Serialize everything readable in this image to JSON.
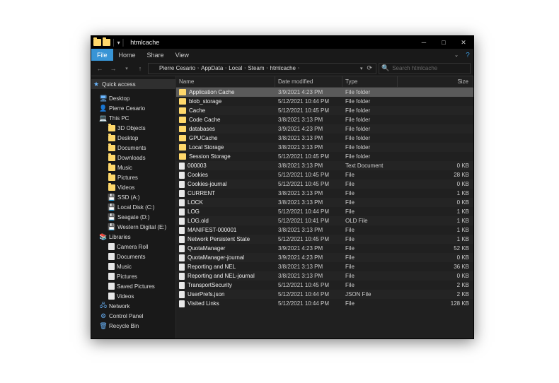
{
  "title": "htmlcache",
  "tabs": {
    "file": "File",
    "home": "Home",
    "share": "Share",
    "view": "View"
  },
  "breadcrumbs": [
    "Pierre Cesario",
    "AppData",
    "Local",
    "Steam",
    "htmlcache"
  ],
  "search_placeholder": "Search htmlcache",
  "tree": {
    "quick_access": "Quick access",
    "nodes": [
      {
        "label": "Desktop",
        "icon": "desktop"
      },
      {
        "label": "Pierre Cesario",
        "icon": "user"
      },
      {
        "label": "This PC",
        "icon": "pc",
        "children": [
          {
            "label": "3D Objects",
            "icon": "folder"
          },
          {
            "label": "Desktop",
            "icon": "folder"
          },
          {
            "label": "Documents",
            "icon": "folder"
          },
          {
            "label": "Downloads",
            "icon": "folder"
          },
          {
            "label": "Music",
            "icon": "folder"
          },
          {
            "label": "Pictures",
            "icon": "folder"
          },
          {
            "label": "Videos",
            "icon": "folder"
          },
          {
            "label": "SSD (A:)",
            "icon": "drive"
          },
          {
            "label": "Local Disk (C:)",
            "icon": "drive"
          },
          {
            "label": "Seagate (D:)",
            "icon": "drive"
          },
          {
            "label": "Western Digital (E:)",
            "icon": "drive"
          }
        ]
      },
      {
        "label": "Libraries",
        "icon": "lib",
        "children": [
          {
            "label": "Camera Roll",
            "icon": "file"
          },
          {
            "label": "Documents",
            "icon": "file"
          },
          {
            "label": "Music",
            "icon": "file"
          },
          {
            "label": "Pictures",
            "icon": "file"
          },
          {
            "label": "Saved Pictures",
            "icon": "file"
          },
          {
            "label": "Videos",
            "icon": "file"
          }
        ]
      },
      {
        "label": "Network",
        "icon": "net"
      },
      {
        "label": "Control Panel",
        "icon": "cp"
      },
      {
        "label": "Recycle Bin",
        "icon": "bin"
      }
    ]
  },
  "columns": {
    "name": "Name",
    "date": "Date modified",
    "type": "Type",
    "size": "Size"
  },
  "files": [
    {
      "name": "Application Cache",
      "date": "3/9/2021 4:23 PM",
      "type": "File folder",
      "size": "",
      "folder": true,
      "selected": true
    },
    {
      "name": "blob_storage",
      "date": "5/12/2021 10:44 PM",
      "type": "File folder",
      "size": "",
      "folder": true
    },
    {
      "name": "Cache",
      "date": "5/12/2021 10:45 PM",
      "type": "File folder",
      "size": "",
      "folder": true
    },
    {
      "name": "Code Cache",
      "date": "3/8/2021 3:13 PM",
      "type": "File folder",
      "size": "",
      "folder": true
    },
    {
      "name": "databases",
      "date": "3/9/2021 4:23 PM",
      "type": "File folder",
      "size": "",
      "folder": true
    },
    {
      "name": "GPUCache",
      "date": "3/8/2021 3:13 PM",
      "type": "File folder",
      "size": "",
      "folder": true
    },
    {
      "name": "Local Storage",
      "date": "3/8/2021 3:13 PM",
      "type": "File folder",
      "size": "",
      "folder": true
    },
    {
      "name": "Session Storage",
      "date": "5/12/2021 10:45 PM",
      "type": "File folder",
      "size": "",
      "folder": true
    },
    {
      "name": "000003",
      "date": "3/8/2021 3:13 PM",
      "type": "Text Document",
      "size": "0 KB",
      "folder": false
    },
    {
      "name": "Cookies",
      "date": "5/12/2021 10:45 PM",
      "type": "File",
      "size": "28 KB",
      "folder": false
    },
    {
      "name": "Cookies-journal",
      "date": "5/12/2021 10:45 PM",
      "type": "File",
      "size": "0 KB",
      "folder": false
    },
    {
      "name": "CURRENT",
      "date": "3/8/2021 3:13 PM",
      "type": "File",
      "size": "1 KB",
      "folder": false
    },
    {
      "name": "LOCK",
      "date": "3/8/2021 3:13 PM",
      "type": "File",
      "size": "0 KB",
      "folder": false
    },
    {
      "name": "LOG",
      "date": "5/12/2021 10:44 PM",
      "type": "File",
      "size": "1 KB",
      "folder": false
    },
    {
      "name": "LOG.old",
      "date": "5/12/2021 10:41 PM",
      "type": "OLD File",
      "size": "1 KB",
      "folder": false
    },
    {
      "name": "MANIFEST-000001",
      "date": "3/8/2021 3:13 PM",
      "type": "File",
      "size": "1 KB",
      "folder": false
    },
    {
      "name": "Network Persistent State",
      "date": "5/12/2021 10:45 PM",
      "type": "File",
      "size": "1 KB",
      "folder": false
    },
    {
      "name": "QuotaManager",
      "date": "3/9/2021 4:23 PM",
      "type": "File",
      "size": "52 KB",
      "folder": false
    },
    {
      "name": "QuotaManager-journal",
      "date": "3/9/2021 4:23 PM",
      "type": "File",
      "size": "0 KB",
      "folder": false
    },
    {
      "name": "Reporting and NEL",
      "date": "3/8/2021 3:13 PM",
      "type": "File",
      "size": "36 KB",
      "folder": false
    },
    {
      "name": "Reporting and NEL-journal",
      "date": "3/8/2021 3:13 PM",
      "type": "File",
      "size": "0 KB",
      "folder": false
    },
    {
      "name": "TransportSecurity",
      "date": "5/12/2021 10:45 PM",
      "type": "File",
      "size": "2 KB",
      "folder": false
    },
    {
      "name": "UserPrefs.json",
      "date": "5/12/2021 10:44 PM",
      "type": "JSON File",
      "size": "2 KB",
      "folder": false
    },
    {
      "name": "Visited Links",
      "date": "5/12/2021 10:44 PM",
      "type": "File",
      "size": "128 KB",
      "folder": false
    }
  ]
}
